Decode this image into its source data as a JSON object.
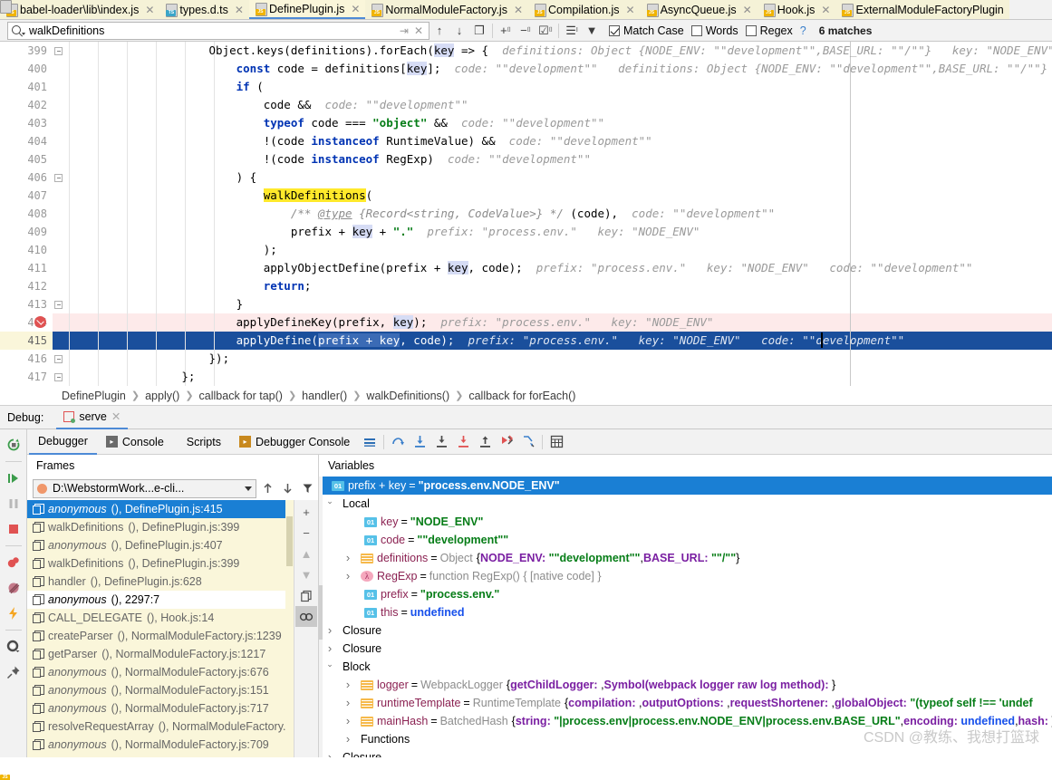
{
  "tabs": [
    {
      "label": "babel-loader\\lib\\index.js",
      "ext": "JS",
      "active": false
    },
    {
      "label": "types.d.ts",
      "ext": "TS",
      "active": false
    },
    {
      "label": "DefinePlugin.js",
      "ext": "JS",
      "active": true
    },
    {
      "label": "NormalModuleFactory.js",
      "ext": "JS",
      "active": false
    },
    {
      "label": "Compilation.js",
      "ext": "JS",
      "active": false
    },
    {
      "label": "AsyncQueue.js",
      "ext": "JS",
      "active": false
    },
    {
      "label": "Hook.js",
      "ext": "JS",
      "active": false
    },
    {
      "label": "ExternalModuleFactoryPlugin",
      "ext": "JS",
      "active": false
    }
  ],
  "search": {
    "value": "walkDefinitions",
    "placeholder": "",
    "match_case_label": "Match Case",
    "words_label": "Words",
    "regex_label": "Regex",
    "match_case_checked": true,
    "words_checked": false,
    "regex_checked": false,
    "help_label": "?",
    "matches": "6 matches",
    "icons": [
      "search-icon",
      "reset-icon",
      "close-icon",
      "prev-icon",
      "next-icon",
      "select-all-icon",
      "add-line-icon",
      "remove-line-icon",
      "select-occurrences-icon",
      "filter-scope-icon",
      "filter-icon"
    ]
  },
  "editor": {
    "first_line": 399,
    "lines": [
      {
        "n": 399,
        "fold": true
      },
      {
        "n": 400,
        "fold": false
      },
      {
        "n": 401,
        "fold": false
      },
      {
        "n": 402,
        "fold": false
      },
      {
        "n": 403,
        "fold": false
      },
      {
        "n": 404,
        "fold": false
      },
      {
        "n": 405,
        "fold": false
      },
      {
        "n": 406,
        "fold": true
      },
      {
        "n": 407,
        "fold": false
      },
      {
        "n": 408,
        "fold": false
      },
      {
        "n": 409,
        "fold": false
      },
      {
        "n": 410,
        "fold": false
      },
      {
        "n": 411,
        "fold": false
      },
      {
        "n": 412,
        "fold": false
      },
      {
        "n": 413,
        "fold": true
      },
      {
        "n": 414,
        "fold": false,
        "breakpoint": true,
        "highlight": "pink"
      },
      {
        "n": 415,
        "fold": false,
        "highlight": "blue"
      },
      {
        "n": 416,
        "fold": true
      },
      {
        "n": 417,
        "fold": true
      }
    ],
    "code_text": {
      "l399": "Object.keys(definitions).forEach(key => {",
      "l399_hint": "definitions: Object {NODE_ENV: \"\"development\"\",BASE_URL: \"\"/\"\"}   key: \"NODE_ENV\"",
      "l400": "const code = definitions[key];",
      "l400_hint": "code: \"\"development\"\"   definitions: Object {NODE_ENV: \"\"development\"\",BASE_URL: \"\"/\"\"}   key: \"NO",
      "l401": "if (",
      "l402": "code &&",
      "l402_hint": "code: \"\"development\"\"",
      "l403": "typeof code === \"object\" &&",
      "l403_hint": "code: \"\"development\"\"",
      "l404": "!(code instanceof RuntimeValue) &&",
      "l404_hint": "code: \"\"development\"\"",
      "l405": "!(code instanceof RegExp)",
      "l405_hint": "code: \"\"development\"\"",
      "l406": ") {",
      "l407": "walkDefinitions(",
      "l408_comment": "/** @type {Record<string, CodeValue>} */ (code),",
      "l408_hint": "code: \"\"development\"\"",
      "l409": "prefix + key + \".\"",
      "l409_hint": "prefix: \"process.env.\"   key: \"NODE_ENV\"",
      "l410": ");",
      "l411": "applyObjectDefine(prefix + key, code);",
      "l411_hint": "prefix: \"process.env.\"   key: \"NODE_ENV\"   code: \"\"development\"\"",
      "l412": "return;",
      "l413": "}",
      "l414": "applyDefineKey(prefix, key);",
      "l414_hint": "prefix: \"process.env.\"   key: \"NODE_ENV\"",
      "l415": "applyDefine(prefix + key, code);",
      "l415_hint": "prefix: \"process.env.\"   key: \"NODE_ENV\"   code: \"\"development\"\"",
      "l416": "});",
      "l417": "};"
    }
  },
  "breadcrumb": [
    "DefinePlugin",
    "apply()",
    "callback for tap()",
    "handler()",
    "walkDefinitions()",
    "callback for forEach()"
  ],
  "debug_header": {
    "label": "Debug:",
    "session": "serve"
  },
  "debug_tabs": [
    {
      "label": "Debugger",
      "active": true,
      "icon": ""
    },
    {
      "label": "Console",
      "active": false,
      "icon": "console-icon"
    },
    {
      "label": "Scripts",
      "active": false,
      "icon": "scripts-icon"
    },
    {
      "label": "Debugger Console",
      "active": false,
      "icon": "debugger-console-icon"
    }
  ],
  "debug_toolbar_icons": [
    "layout-icon",
    "step-over-icon",
    "step-into-icon",
    "force-step-into-icon",
    "smart-step-into-icon",
    "step-out-icon",
    "run-to-cursor-icon",
    "drop-frame-icon",
    "evaluate-expression-icon"
  ],
  "vtoolbar_icons": [
    "rerun-icon",
    "resume-icon",
    "pause-icon",
    "stop-icon",
    "view-breakpoints-icon",
    "mute-breakpoints-icon",
    "force-run-icon",
    "settings-icon",
    "pin-icon"
  ],
  "frames": {
    "title": "Frames",
    "thread": "D:\\WebstormWork...e-cli...",
    "buttons": [
      "up-icon",
      "down-icon",
      "filter-icon",
      "add-icon"
    ],
    "side_buttons": [
      "plus-icon",
      "minus-icon",
      "up-arrow-icon",
      "down-arrow-icon",
      "copy-icon",
      "watches-icon"
    ],
    "items": [
      {
        "fn": "anonymous",
        "italic": true,
        "loc": "(), DefinePlugin.js:415",
        "selected": true
      },
      {
        "fn": "walkDefinitions",
        "italic": false,
        "loc": "(), DefinePlugin.js:399",
        "selected": false
      },
      {
        "fn": "anonymous",
        "italic": true,
        "loc": "(), DefinePlugin.js:407",
        "selected": false
      },
      {
        "fn": "walkDefinitions",
        "italic": false,
        "loc": "(), DefinePlugin.js:399",
        "selected": false
      },
      {
        "fn": "handler",
        "italic": false,
        "loc": "(), DefinePlugin.js:628",
        "selected": false
      },
      {
        "fn": "anonymous",
        "italic": true,
        "loc": "(), 2297:7",
        "selected": false,
        "white": true
      },
      {
        "fn": "CALL_DELEGATE",
        "italic": false,
        "loc": "(), Hook.js:14",
        "selected": false
      },
      {
        "fn": "createParser",
        "italic": false,
        "loc": "(), NormalModuleFactory.js:1239",
        "selected": false
      },
      {
        "fn": "getParser",
        "italic": false,
        "loc": "(), NormalModuleFactory.js:1217",
        "selected": false
      },
      {
        "fn": "anonymous",
        "italic": true,
        "loc": "(), NormalModuleFactory.js:676",
        "selected": false
      },
      {
        "fn": "anonymous",
        "italic": true,
        "loc": "(), NormalModuleFactory.js:151",
        "selected": false
      },
      {
        "fn": "anonymous",
        "italic": true,
        "loc": "(), NormalModuleFactory.js:717",
        "selected": false
      },
      {
        "fn": "resolveRequestArray",
        "italic": false,
        "loc": "(), NormalModuleFactory.",
        "selected": false
      },
      {
        "fn": "anonymous",
        "italic": true,
        "loc": "(), NormalModuleFactory.js:709",
        "selected": false
      }
    ]
  },
  "variables": {
    "title": "Variables",
    "rows": [
      {
        "indent": 1,
        "arrow": "none",
        "icon": "01",
        "name": "prefix + key",
        "eq": "=",
        "value": "\"process.env.NODE_ENV\"",
        "value_kind": "str",
        "selected": true
      },
      {
        "indent": 0,
        "arrow": "down",
        "icon": "none",
        "name": "Local",
        "plain": true
      },
      {
        "indent": 2,
        "arrow": "none",
        "icon": "01",
        "name": "key",
        "eq": "=",
        "value": "\"NODE_ENV\"",
        "value_kind": "str"
      },
      {
        "indent": 2,
        "arrow": "none",
        "icon": "01",
        "name": "code",
        "eq": "=",
        "value": "\"\"development\"\"",
        "value_kind": "str"
      },
      {
        "indent": 1,
        "arrow": "right",
        "icon": "obj",
        "name": "definitions",
        "eq": "=",
        "type": "Object",
        "value": "{NODE_ENV: \"\"development\"\",BASE_URL: \"\"/\"\"}",
        "value_kind": "obj"
      },
      {
        "indent": 1,
        "arrow": "right",
        "icon": "fn",
        "name": "RegExp",
        "eq": "=",
        "type": "function RegExp() { [native code] }",
        "value_kind": "type"
      },
      {
        "indent": 2,
        "arrow": "none",
        "icon": "01",
        "name": "prefix",
        "eq": "=",
        "value": "\"process.env.\"",
        "value_kind": "str"
      },
      {
        "indent": 2,
        "arrow": "none",
        "icon": "01",
        "name": "this",
        "eq": "=",
        "value": "undefined",
        "value_kind": "num"
      },
      {
        "indent": 0,
        "arrow": "right",
        "icon": "none",
        "name": "Closure",
        "plain": true
      },
      {
        "indent": 0,
        "arrow": "right",
        "icon": "none",
        "name": "Closure",
        "plain": true
      },
      {
        "indent": 0,
        "arrow": "down",
        "icon": "none",
        "name": "Block",
        "plain": true
      },
      {
        "indent": 1,
        "arrow": "right",
        "icon": "obj",
        "name": "logger",
        "eq": "=",
        "type": "WebpackLogger",
        "value": "{getChildLogger: ,Symbol(webpack logger raw log method): }",
        "value_kind": "obj"
      },
      {
        "indent": 1,
        "arrow": "right",
        "icon": "obj",
        "name": "runtimeTemplate",
        "eq": "=",
        "type": "RuntimeTemplate",
        "value": "{compilation: ,outputOptions: ,requestShortener: ,globalObject: \"(typeof self !== 'undef",
        "value_kind": "obj"
      },
      {
        "indent": 1,
        "arrow": "right",
        "icon": "obj",
        "name": "mainHash",
        "eq": "=",
        "type": "BatchedHash",
        "value": "{string: \"|process.env|process.env.NODE_ENV|process.env.BASE_URL\",encoding: undefined,hash: }",
        "value_kind": "obj"
      },
      {
        "indent": 1,
        "arrow": "right",
        "icon": "none",
        "name": "Functions",
        "plain": true
      },
      {
        "indent": 0,
        "arrow": "right",
        "icon": "none",
        "name": "Closure",
        "plain": true
      }
    ]
  },
  "watermark": "CSDN @教练、我想打篮球",
  "colors": {
    "accent": "#1a7fd4",
    "tab_bg": "#f5f2d7",
    "selection": "#1a4f9c",
    "exec_line_pink": "#fdeaea",
    "search_highlight": "#ffe92b",
    "keyword": "#0033b3",
    "string": "#067d17",
    "hint": "#9a9a9a"
  }
}
